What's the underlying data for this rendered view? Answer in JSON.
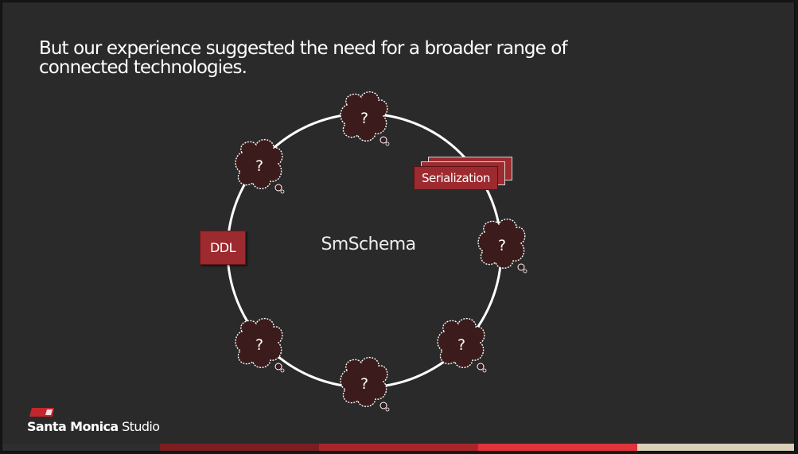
{
  "slide": {
    "title": "But our experience suggested the need for a broader range of connected technologies.",
    "center_label": "SmSchema",
    "ddl_label": "DDL",
    "serialization_label": "Serialization",
    "unknown_label": "?"
  },
  "logo": {
    "brand_bold": "Santa Monica",
    "brand_light": " Studio"
  },
  "colors": {
    "background": "#2a2a2a",
    "accent_red": "#9c2a2e",
    "cloud_fill": "#3a1c1c",
    "footer": [
      "#2e2e2e",
      "#7a1e22",
      "#a8262b",
      "#e0333a",
      "#d9d0b8"
    ]
  }
}
